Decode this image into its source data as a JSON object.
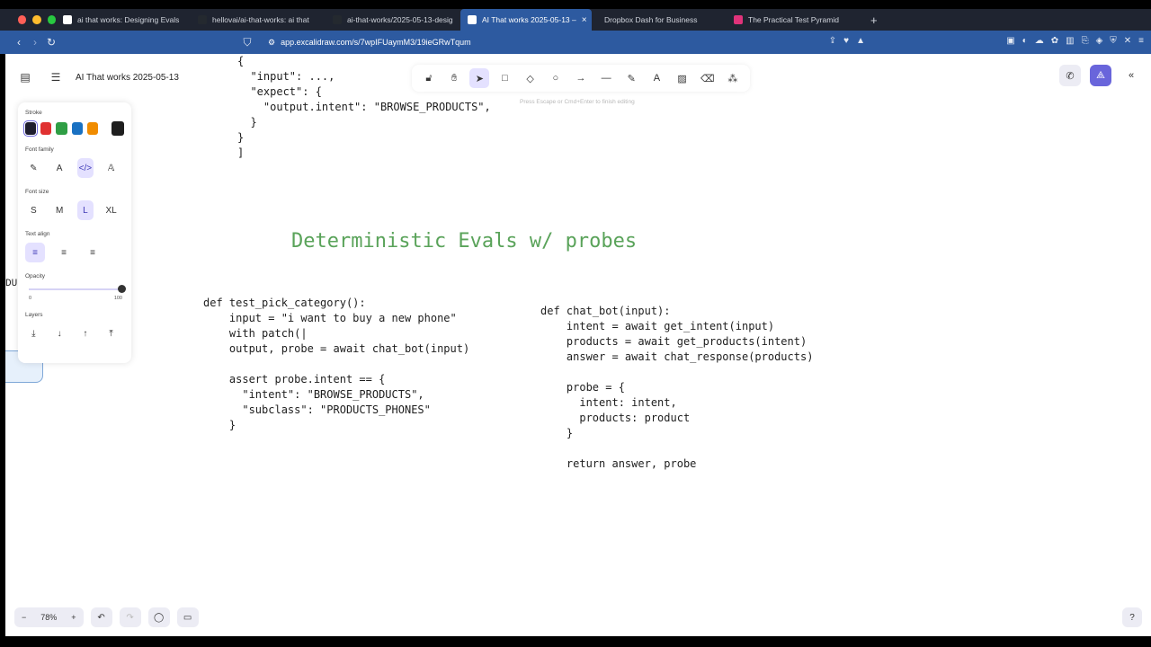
{
  "browser": {
    "tabs": [
      {
        "label": "ai that works: Designing Evals",
        "color": "#ffffff",
        "active": false
      },
      {
        "label": "hellovai/ai-that-works: ai that",
        "color": "#24292f",
        "active": false
      },
      {
        "label": "ai-that-works/2025-05-13-desig",
        "color": "#24292f",
        "active": false
      },
      {
        "label": "AI That works 2025-05-13 –",
        "color": "#ffffff",
        "active": true
      },
      {
        "label": "Dropbox Dash for Business",
        "color": "#1f2430",
        "active": false
      },
      {
        "label": "The Practical Test Pyramid",
        "color": "#e0337a",
        "active": false
      }
    ],
    "new_tab": "+",
    "close_tab": "×",
    "url": "app.excalidraw.com/s/7wpIFUaymM3/19ieGRwTqum"
  },
  "app": {
    "doc_title": "AI That works 2025-05-13",
    "edit_hint": "Press Escape or Cmd+Enter to finish editing",
    "accent": "#6965db"
  },
  "panel": {
    "stroke_label": "Stroke",
    "stroke_colors": [
      "#1e1e2e",
      "#e03131",
      "#2f9e44",
      "#1971c2",
      "#f08c00"
    ],
    "current_stroke": "#1e1e1e",
    "font_family_label": "Font family",
    "font_family_options": [
      "✎",
      "A",
      "</>",
      "𝔸"
    ],
    "font_size_label": "Font size",
    "font_sizes": [
      "S",
      "M",
      "L",
      "XL"
    ],
    "text_align_label": "Text align",
    "opacity_label": "Opacity",
    "opacity_min": "0",
    "opacity_max": "100",
    "opacity_value": 100,
    "layers_label": "Layers"
  },
  "canvas": {
    "json_snippet": "{\n  \"input\": ...,\n  \"expect\": {\n    \"output.intent\": \"BROWSE_PRODUCTS\",\n  }\n}\n]",
    "heading": "Deterministic Evals w/ probes",
    "test_code": "def test_pick_category():\n    input = \"i want to buy a new phone\"\n    with patch(|\n    output, probe = await chat_bot(input)\n\n    assert probe.intent == {\n      \"intent\": \"BROWSE_PRODUCTS\",\n      \"subclass\": \"PRODUCTS_PHONES\"\n    }",
    "bot_code": "def chat_bot(input):\n    intent = await get_intent(input)\n    products = await get_products(intent)\n    answer = await chat_response(products)\n\n    probe = {\n      intent: intent,\n      products: product\n    }\n\n    return answer, probe",
    "offscreen_text": "DU",
    "heading_color": "#5aa35a"
  },
  "footer": {
    "zoom": "78%",
    "zoom_out": "−",
    "zoom_in": "+"
  }
}
